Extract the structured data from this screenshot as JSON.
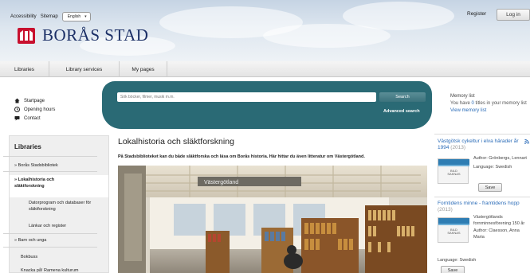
{
  "header": {
    "accessibility_label": "Accessibility",
    "sitemap_label": "Sitemap",
    "language_selected": "English",
    "site_name": "BORÅS STAD",
    "register_label": "Register",
    "login_label": "Log in",
    "brand_color": "#c8102e"
  },
  "nav": {
    "items": [
      "Libraries",
      "Library services",
      "My pages"
    ]
  },
  "search": {
    "placeholder": "Sök böcker, filmer, musik m.m.",
    "button_label": "Search",
    "advanced_label": "Advanced search",
    "band_color": "#2a6a75"
  },
  "quick_links": [
    "Startpage",
    "Opening hours",
    "Contact"
  ],
  "sidebar": {
    "title": "Libraries",
    "items": [
      "Borås Stadsbibliotek",
      "Lokalhistoria och släktforskning",
      "Datorprogram och databaser för släktforskning",
      "Länkar och register",
      "Barn och unga",
      "Bokbuss",
      "Knacka på! Ramena kulturum"
    ]
  },
  "main": {
    "title": "Lokalhistoria och släktforskning",
    "intro": "På Stadsbiblioteket kan du både släktforska och läsa om Borås historia. Här hittar du även litteratur om Västergötland.",
    "hero_sign": "Västergötland"
  },
  "memory": {
    "title": "Memory list",
    "text_before": "You have",
    "count": "0",
    "text_after": "titles in your memory list",
    "view_label": "View memory list"
  },
  "books": [
    {
      "title": "Västgötsk cykeltur i elva härader år 1994",
      "year": "(2013)",
      "meta": "Author: Grönbergs, Lennart",
      "language": "Language: Swedish",
      "save": "Save",
      "cover_label": "BILD SAKNAS"
    },
    {
      "title": "Forntidens minne - framtidens hopp",
      "year": "(2013)",
      "meta": "Västergötlands fornminnesförening 150 år",
      "author": "Author: Claesson, Anna Maria",
      "language": "Language: Swedish",
      "save": "Save",
      "cover_label": "BILD SAKNAS"
    }
  ],
  "icons": {
    "home": "home-icon",
    "clock": "clock-icon",
    "contact": "contact-icon",
    "rss": "rss-icon"
  }
}
